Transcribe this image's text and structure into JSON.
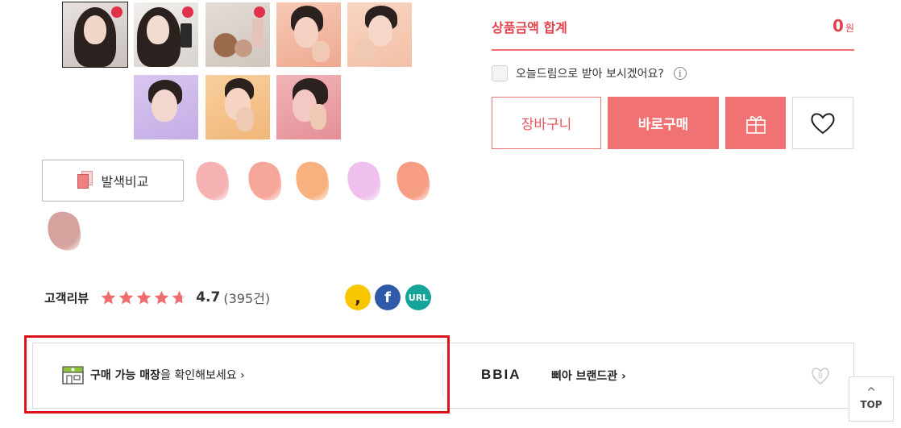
{
  "order": {
    "total_label": "상품금액 합계",
    "total_value": "0",
    "total_unit": "원",
    "today_delivery_label": "오늘드림으로 받아 보시겠어요?",
    "info_glyph": "i",
    "cart_label": "장바구니",
    "buy_label": "바로구매",
    "gift_icon": "gift-icon",
    "wish_icon": "heart-icon"
  },
  "gallery": {
    "thumbnail_count": 8,
    "selected_index": 0
  },
  "color_compare": {
    "label": "발색비교",
    "swatches": [
      "#f6b1b3",
      "#f7a79a",
      "#f8b17e",
      "#efc0ee",
      "#f79d84",
      "#d4a39d"
    ]
  },
  "review": {
    "label": "고객리뷰",
    "rating": "4.7",
    "count": "(395건)",
    "stars": 4.7
  },
  "share": {
    "kakao": ",",
    "facebook": "f",
    "url": "URL"
  },
  "store": {
    "bold_text": "구매 가능 매장",
    "rest_text": "을 확인해보세요 ›",
    "brand_logo": "BBIA",
    "brand_link": "삐아 브랜드관 ›",
    "brand_heart_letter": "B"
  },
  "top_button": {
    "arrow": "^",
    "label": "TOP"
  },
  "colors": {
    "accent": "#f07272",
    "accent_text": "#e0454f",
    "highlight_border": "#d9141b"
  }
}
